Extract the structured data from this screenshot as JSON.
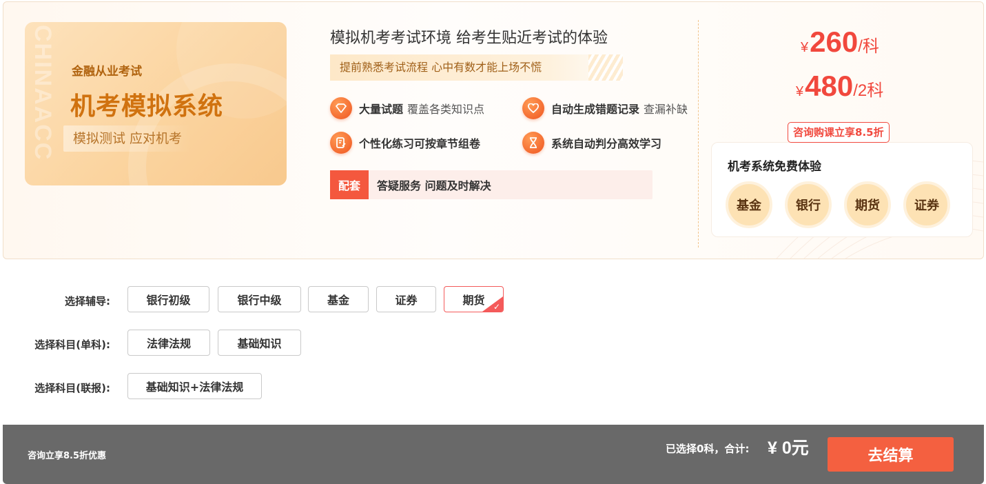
{
  "banner": {
    "card": {
      "watermark": "CHINAACC",
      "subtitle": "金融从业考试",
      "title": "机考模拟系统",
      "tagline": "模拟测试 应对机考"
    },
    "headline": "模拟机考考试环境 给考生贴近考试的体验",
    "strip": "提前熟悉考试流程 心中有数才能上场不慌",
    "features": [
      {
        "bold": "大量试题",
        "light": "覆盖各类知识点",
        "icon": "diamond-icon"
      },
      {
        "bold": "自动生成错题记录",
        "light": "查漏补缺",
        "icon": "heart-icon"
      },
      {
        "bold": "个性化练习可按章节组卷",
        "light": "",
        "icon": "document-edit-icon"
      },
      {
        "bold": "系统自动判分高效学习",
        "light": "",
        "icon": "hourglass-icon"
      }
    ],
    "support": {
      "badge": "配套",
      "text": "答疑服务 问题及时解决"
    }
  },
  "pricing": {
    "currency": "¥",
    "single": {
      "amount": "260",
      "unit": "/科"
    },
    "double": {
      "amount": "480",
      "unit": "/2科"
    },
    "promo": "咨询购课立享8.5折",
    "trial": {
      "title": "机考系统免费体验",
      "items": [
        "基金",
        "银行",
        "期货",
        "证券"
      ]
    }
  },
  "selection": {
    "tutoring": {
      "label": "选择辅导:",
      "options": [
        "银行初级",
        "银行中级",
        "基金",
        "证券",
        "期货"
      ],
      "selected": "期货"
    },
    "single_subject": {
      "label": "选择科目(单科):",
      "options": [
        "法律法规",
        "基础知识"
      ]
    },
    "combo_subject": {
      "label": "选择科目(联报):",
      "options": [
        "基础知识+法律法规"
      ]
    }
  },
  "footer": {
    "note": "咨询立享8.5折优惠",
    "summary": "已选择0科，合计:",
    "total": "¥ 0元",
    "checkout": "去结算"
  },
  "colors": {
    "accent_red": "#f1483d",
    "accent_orange": "#ef5520",
    "checkout_button": "#f46040",
    "footer_bg": "#696969",
    "card_gold": "#fbd49f"
  }
}
